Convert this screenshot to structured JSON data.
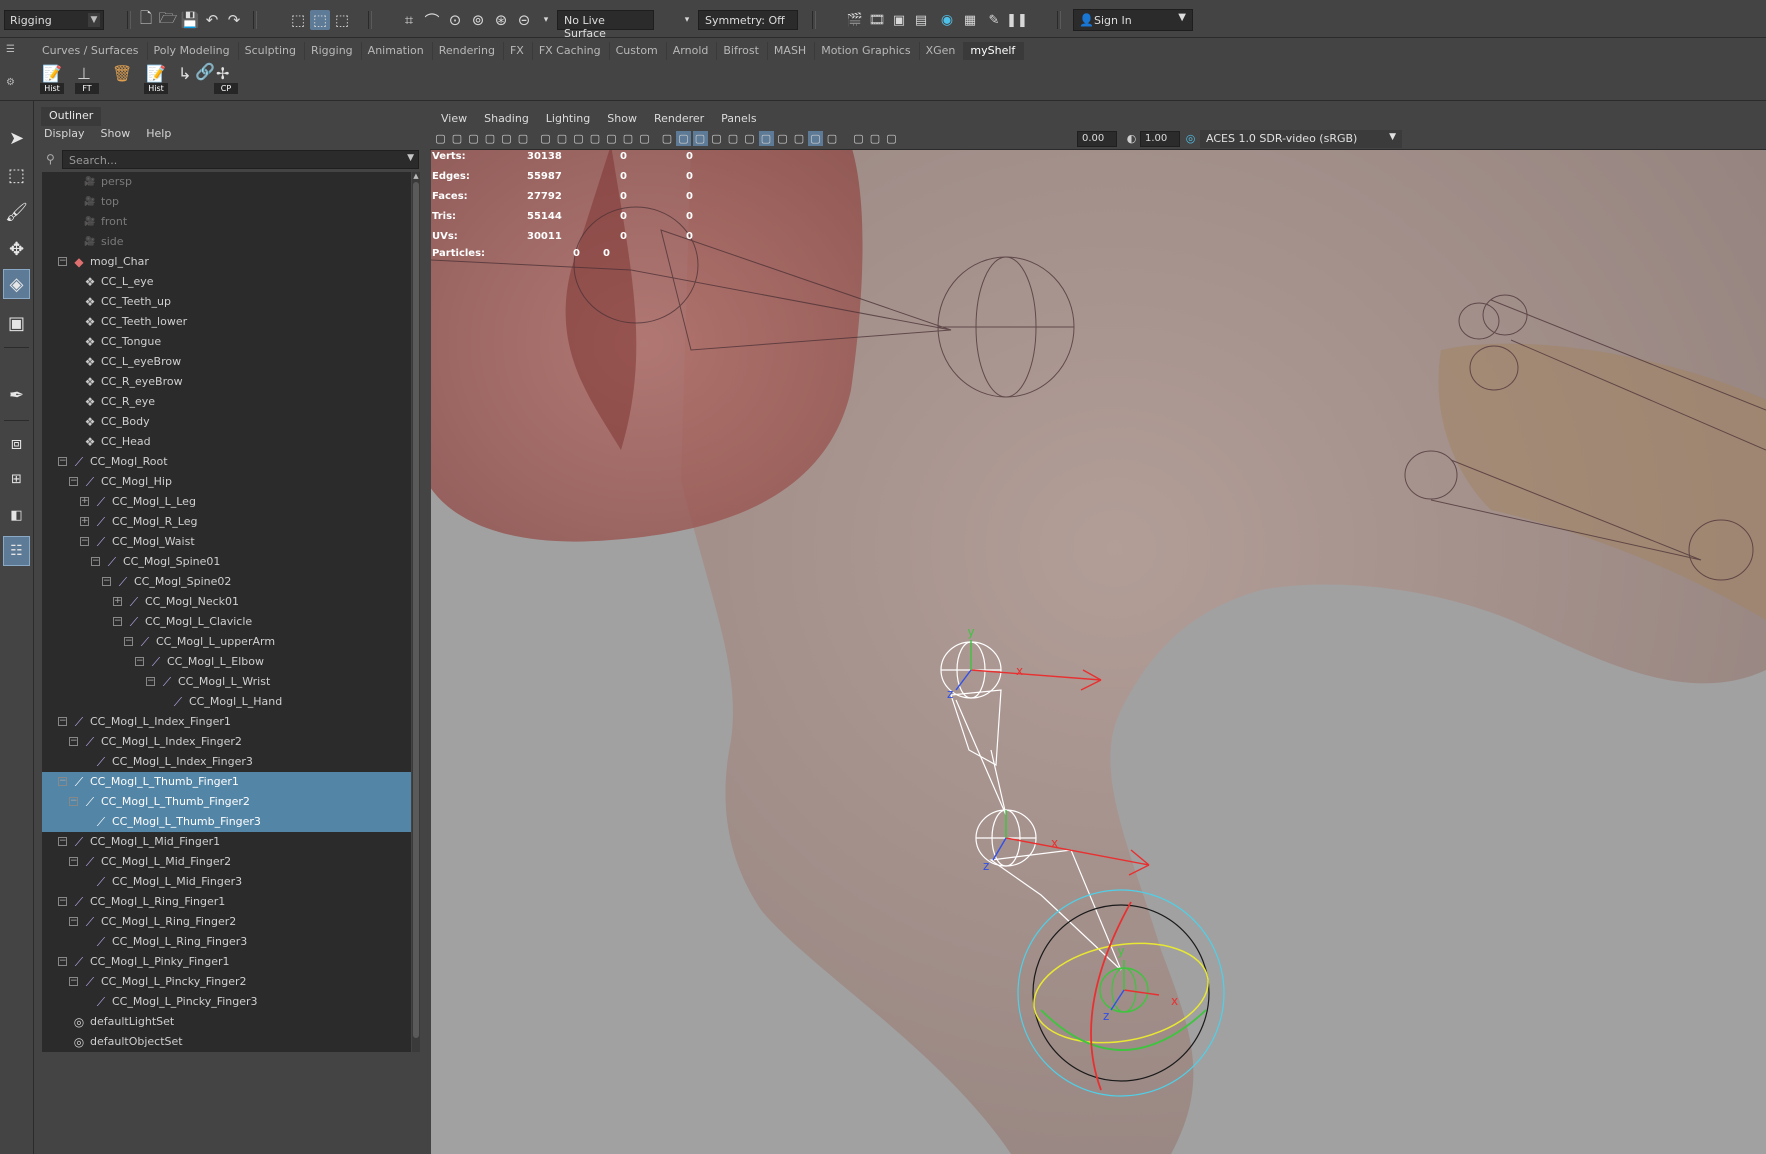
{
  "status_line": {
    "menu_set": "Rigging",
    "live_surface": "No Live Surface",
    "symmetry": "Symmetry: Off",
    "sign_in": "Sign In"
  },
  "shelf": {
    "tabs": [
      "Curves / Surfaces",
      "Poly Modeling",
      "Sculpting",
      "Rigging",
      "Animation",
      "Rendering",
      "FX",
      "FX Caching",
      "Custom",
      "Arnold",
      "Bifrost",
      "MASH",
      "Motion Graphics",
      "XGen",
      "myShelf"
    ],
    "active_tab": "myShelf",
    "buttons": [
      {
        "label": "Hist",
        "icon": "edit-history-icon"
      },
      {
        "label": "FT",
        "icon": "freeze-transform-icon"
      },
      {
        "label": "",
        "icon": "delete-history-icon"
      },
      {
        "label": "Hist",
        "icon": "edit-history-icon"
      },
      {
        "label": "",
        "icon": "axis-icon"
      },
      {
        "label": "",
        "icon": "link-icon"
      },
      {
        "label": "CP",
        "icon": "center-pivot-icon"
      }
    ]
  },
  "outliner": {
    "tab": "Outliner",
    "menu": [
      "Display",
      "Show",
      "Help"
    ],
    "search_placeholder": "Search...",
    "rows": [
      {
        "label": "persp",
        "indent": 2,
        "icon": "camera-icon",
        "dim": true
      },
      {
        "label": "top",
        "indent": 2,
        "icon": "camera-icon",
        "dim": true
      },
      {
        "label": "front",
        "indent": 2,
        "icon": "camera-icon",
        "dim": true
      },
      {
        "label": "side",
        "indent": 2,
        "icon": "camera-icon",
        "dim": true
      },
      {
        "label": "mogl_Char",
        "indent": 1,
        "icon": "group-icon",
        "expander": "minus"
      },
      {
        "label": "CC_L_eye",
        "indent": 2,
        "icon": "mesh-icon"
      },
      {
        "label": "CC_Teeth_up",
        "indent": 2,
        "icon": "mesh-icon"
      },
      {
        "label": "CC_Teeth_lower",
        "indent": 2,
        "icon": "mesh-icon"
      },
      {
        "label": "CC_Tongue",
        "indent": 2,
        "icon": "mesh-icon"
      },
      {
        "label": "CC_L_eyeBrow",
        "indent": 2,
        "icon": "mesh-icon"
      },
      {
        "label": "CC_R_eyeBrow",
        "indent": 2,
        "icon": "mesh-icon"
      },
      {
        "label": "CC_R_eye",
        "indent": 2,
        "icon": "mesh-icon"
      },
      {
        "label": "CC_Body",
        "indent": 2,
        "icon": "mesh-icon"
      },
      {
        "label": "CC_Head",
        "indent": 2,
        "icon": "mesh-icon"
      },
      {
        "label": "CC_Mogl_Root",
        "indent": 1,
        "icon": "joint-icon",
        "expander": "minus"
      },
      {
        "label": "CC_Mogl_Hip",
        "indent": 2,
        "icon": "joint-icon",
        "expander": "minus"
      },
      {
        "label": "CC_Mogl_L_Leg",
        "indent": 3,
        "icon": "joint-icon",
        "expander": "plus"
      },
      {
        "label": "CC_Mogl_R_Leg",
        "indent": 3,
        "icon": "joint-icon",
        "expander": "plus"
      },
      {
        "label": "CC_Mogl_Waist",
        "indent": 3,
        "icon": "joint-icon",
        "expander": "minus"
      },
      {
        "label": "CC_Mogl_Spine01",
        "indent": 4,
        "icon": "joint-icon",
        "expander": "minus"
      },
      {
        "label": "CC_Mogl_Spine02",
        "indent": 5,
        "icon": "joint-icon",
        "expander": "minus"
      },
      {
        "label": "CC_Mogl_Neck01",
        "indent": 6,
        "icon": "joint-icon",
        "expander": "plus"
      },
      {
        "label": "CC_Mogl_L_Clavicle",
        "indent": 6,
        "icon": "joint-icon",
        "expander": "minus"
      },
      {
        "label": "CC_Mogl_L_upperArm",
        "indent": 7,
        "icon": "joint-icon",
        "expander": "minus"
      },
      {
        "label": "CC_Mogl_L_Elbow",
        "indent": 8,
        "icon": "joint-icon",
        "expander": "minus"
      },
      {
        "label": "CC_Mogl_L_Wrist",
        "indent": 9,
        "icon": "joint-icon",
        "expander": "minus"
      },
      {
        "label": "CC_Mogl_L_Hand",
        "indent": 10,
        "icon": "joint-icon"
      },
      {
        "label": "CC_Mogl_L_Index_Finger1",
        "indent": 1,
        "icon": "joint-icon",
        "expander": "minus"
      },
      {
        "label": "CC_Mogl_L_Index_Finger2",
        "indent": 2,
        "icon": "joint-icon",
        "expander": "minus"
      },
      {
        "label": "CC_Mogl_L_Index_Finger3",
        "indent": 3,
        "icon": "joint-icon"
      },
      {
        "label": "CC_Mogl_L_Thumb_Finger1",
        "indent": 1,
        "icon": "joint-icon",
        "expander": "minus",
        "selected": true
      },
      {
        "label": "CC_Mogl_L_Thumb_Finger2",
        "indent": 2,
        "icon": "joint-icon",
        "expander": "minus",
        "selected": true
      },
      {
        "label": "CC_Mogl_L_Thumb_Finger3",
        "indent": 3,
        "icon": "joint-icon",
        "selected": true
      },
      {
        "label": "CC_Mogl_L_Mid_Finger1",
        "indent": 1,
        "icon": "joint-icon",
        "expander": "minus"
      },
      {
        "label": "CC_Mogl_L_Mid_Finger2",
        "indent": 2,
        "icon": "joint-icon",
        "expander": "minus"
      },
      {
        "label": "CC_Mogl_L_Mid_Finger3",
        "indent": 3,
        "icon": "joint-icon"
      },
      {
        "label": "CC_Mogl_L_Ring_Finger1",
        "indent": 1,
        "icon": "joint-icon",
        "expander": "minus"
      },
      {
        "label": "CC_Mogl_L_Ring_Finger2",
        "indent": 2,
        "icon": "joint-icon",
        "expander": "minus"
      },
      {
        "label": "CC_Mogl_L_Ring_Finger3",
        "indent": 3,
        "icon": "joint-icon"
      },
      {
        "label": "CC_Mogl_L_Pinky_Finger1",
        "indent": 1,
        "icon": "joint-icon",
        "expander": "minus"
      },
      {
        "label": "CC_Mogl_L_Pincky_Finger2",
        "indent": 2,
        "icon": "joint-icon",
        "expander": "minus"
      },
      {
        "label": "CC_Mogl_L_Pincky_Finger3",
        "indent": 3,
        "icon": "joint-icon"
      },
      {
        "label": "defaultLightSet",
        "indent": 1,
        "icon": "set-icon"
      },
      {
        "label": "defaultObjectSet",
        "indent": 1,
        "icon": "set-icon"
      }
    ]
  },
  "viewport": {
    "menu": [
      "View",
      "Shading",
      "Lighting",
      "Show",
      "Renderer",
      "Panels"
    ],
    "gamma_value": "0.00",
    "exposure_value": "1.00",
    "color_space": "ACES 1.0 SDR-video (sRGB)",
    "hud": {
      "rows": [
        {
          "label": "Verts:",
          "v1": "30138",
          "v2": "0",
          "v3": "0"
        },
        {
          "label": "Edges:",
          "v1": "55987",
          "v2": "0",
          "v3": "0"
        },
        {
          "label": "Faces:",
          "v1": "27792",
          "v2": "0",
          "v3": "0"
        },
        {
          "label": "Tris:",
          "v1": "55144",
          "v2": "0",
          "v3": "0"
        },
        {
          "label": "UVs:",
          "v1": "30011",
          "v2": "0",
          "v3": "0"
        }
      ],
      "particles_label": "Particles:",
      "particles_v1": "0",
      "particles_v2": "0"
    },
    "axis_labels": {
      "x": "x",
      "y": "y",
      "z": "z"
    }
  },
  "colors": {
    "selection": "#5285a6",
    "active_tool": "#5d7a96",
    "viewport_bg": "#a1a1a1",
    "joint_icon": "#b8a6e8"
  }
}
